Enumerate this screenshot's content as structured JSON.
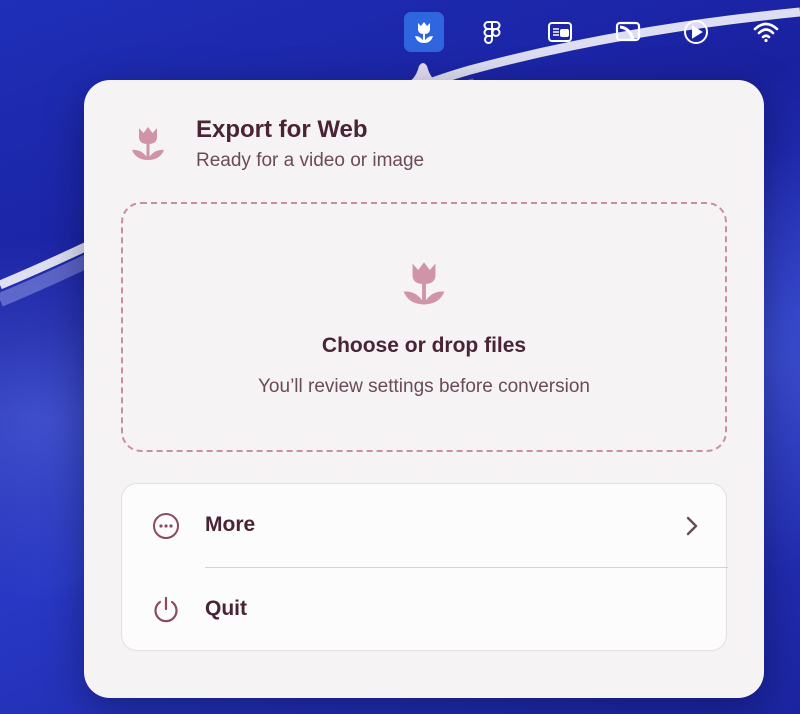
{
  "menubar": {
    "icons": [
      "tulip-icon",
      "figma-icon",
      "keyboard-window-icon",
      "cast-icon",
      "play-icon",
      "wifi-icon"
    ]
  },
  "popover": {
    "title": "Export for Web",
    "subtitle": "Ready for a video or image",
    "dropzone": {
      "title": "Choose or drop files",
      "subtitle": "You’ll review settings before conversion"
    },
    "menu": {
      "more_label": "More",
      "quit_label": "Quit"
    }
  },
  "colors": {
    "accent": "#c98ea3",
    "text": "#4a2435",
    "menubar_active": "#2f66e0"
  }
}
